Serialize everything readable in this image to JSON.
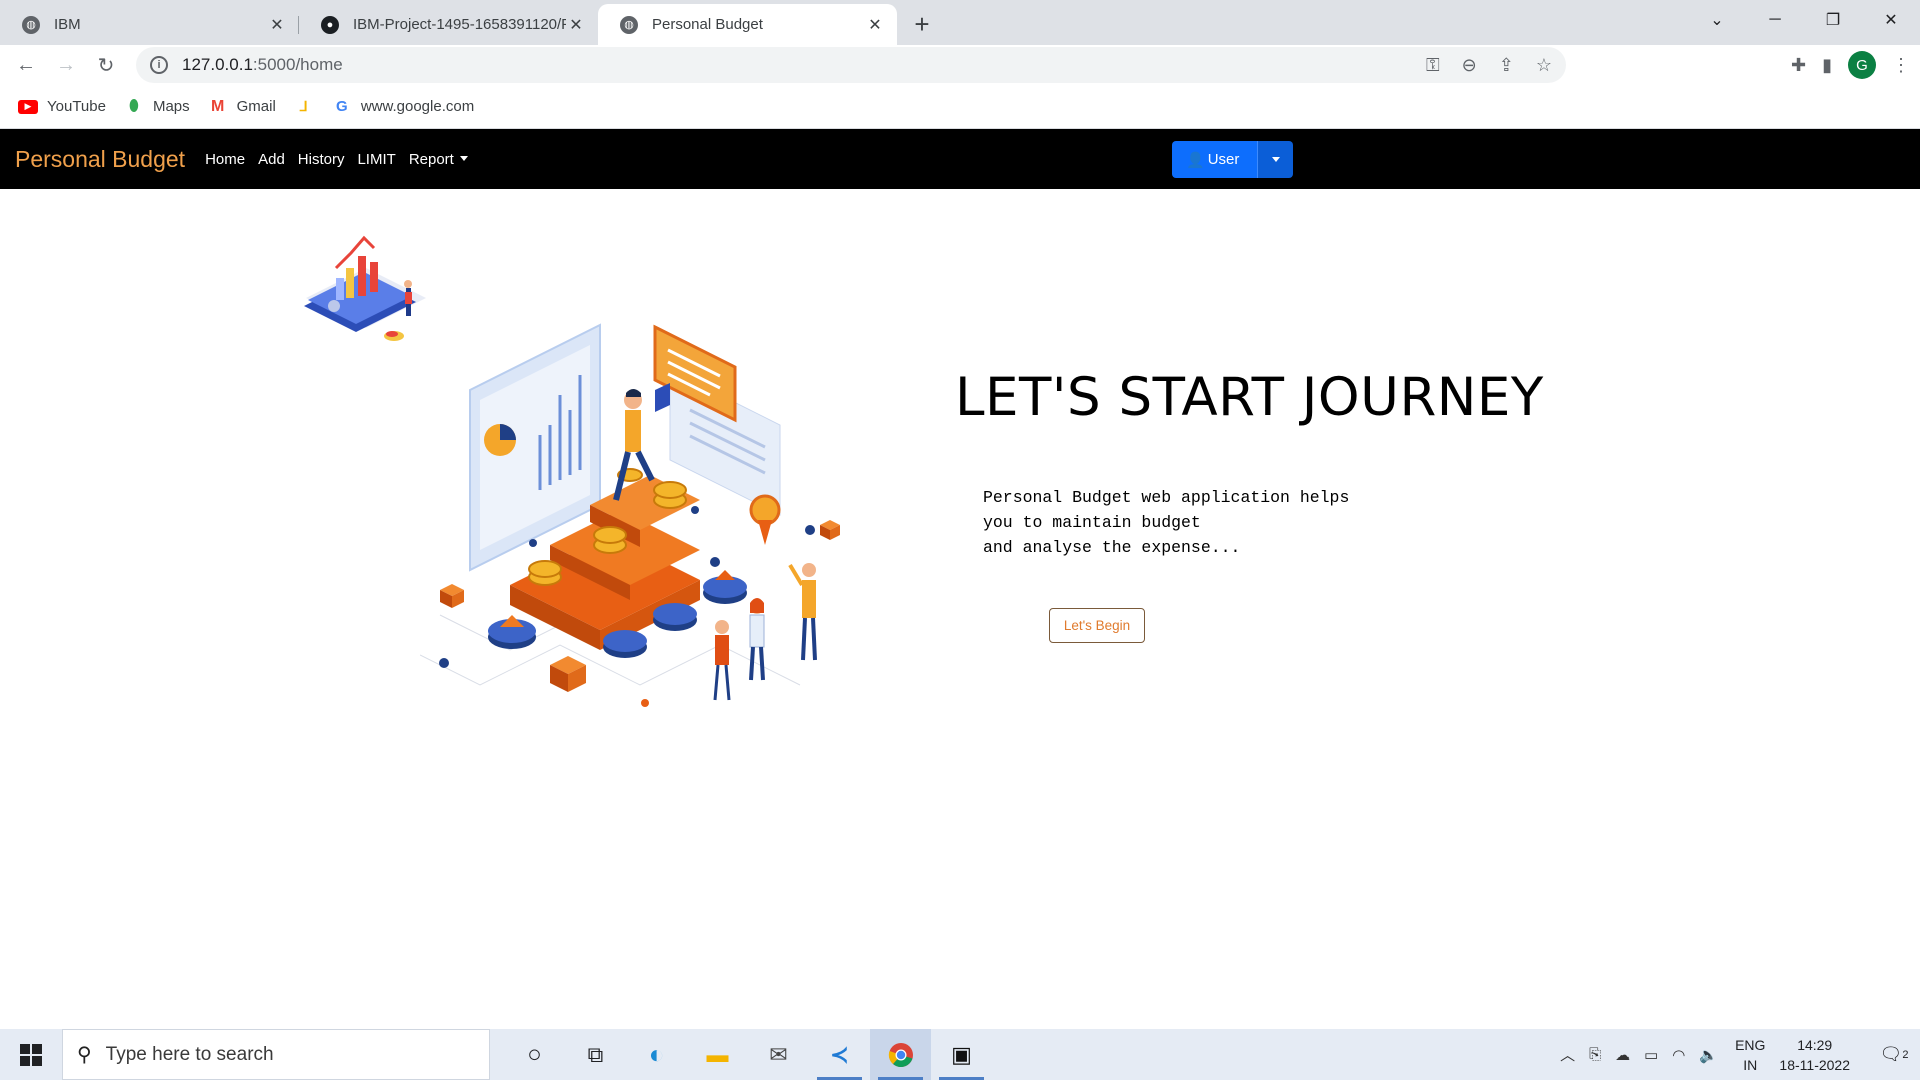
{
  "browser": {
    "tabs": [
      {
        "title": "IBM",
        "active": false
      },
      {
        "title": "IBM-Project-1495-1658391120/P",
        "active": false
      },
      {
        "title": "Personal Budget",
        "active": true
      }
    ],
    "url_host": "127.0.0.1",
    "url_path": ":5000/home",
    "avatar_letter": "G",
    "bookmarks": [
      {
        "label": "YouTube",
        "icon": "youtube-icon",
        "color": "#ff0000"
      },
      {
        "label": "Maps",
        "icon": "maps-icon",
        "color": "#34a853"
      },
      {
        "label": "Gmail",
        "icon": "gmail-icon",
        "color": "#ea4335"
      },
      {
        "label": "",
        "icon": "bookmark-app-icon",
        "color": "#f4b400"
      },
      {
        "label": "www.google.com",
        "icon": "google-icon",
        "color": "#4285f4"
      }
    ]
  },
  "app": {
    "brand": "Personal Budget",
    "nav": {
      "home": "Home",
      "add": "Add",
      "history": "History",
      "limit": "LIMIT",
      "report": "Report"
    },
    "user_button": "User",
    "hero": {
      "title": "LET'S START JOURNEY",
      "line1": "Personal Budget web application helps",
      "line2": "you to maintain budget",
      "line3": "and analyse the expense...",
      "cta": "Let's Begin"
    },
    "colors": {
      "brand": "#f0a04b",
      "primary": "#0d6efd",
      "navbar": "#000000",
      "accent": "#e07b2e"
    }
  },
  "taskbar": {
    "search_placeholder": "Type here to search",
    "lang_top": "ENG",
    "lang_bottom": "IN",
    "time": "14:29",
    "date": "18-11-2022",
    "notif_count": "2"
  }
}
